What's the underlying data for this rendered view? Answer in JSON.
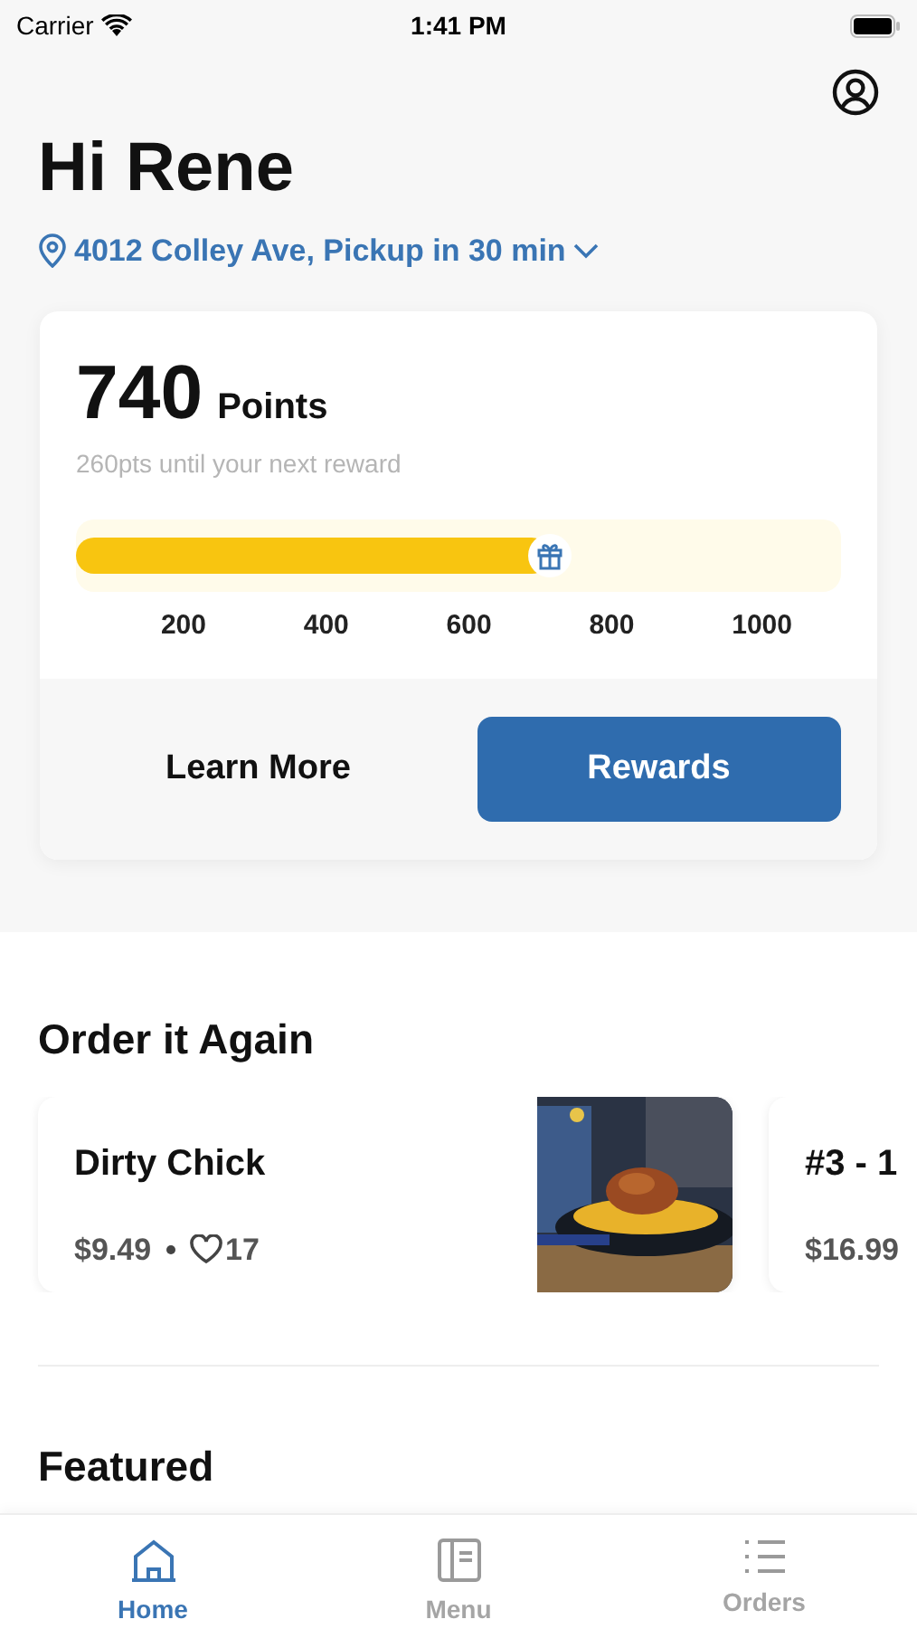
{
  "status_bar": {
    "carrier": "Carrier",
    "time": "1:41 PM"
  },
  "greeting": "Hi Rene",
  "location": "4012 Colley Ave, Pickup in 30 min",
  "rewards": {
    "points": "740",
    "points_label": "Points",
    "subtitle": "260pts until your next reward",
    "level": 0.62,
    "scale": [
      "200",
      "400",
      "600",
      "800",
      "1000"
    ],
    "buttons": [
      {
        "label": "Learn More",
        "kind": "plain"
      },
      {
        "label": "Rewards",
        "kind": "primary"
      }
    ]
  },
  "order_again": {
    "title": "Order it Again",
    "items": [
      {
        "name": "Dirty Chick",
        "price": "$9.49",
        "likes": "17",
        "kind": "picture"
      },
      {
        "name": "#3 - 1",
        "price": "$16.99"
      }
    ]
  },
  "featured": {
    "title": "Featured"
  },
  "tabs": [
    {
      "label": "Home",
      "selected": true
    },
    {
      "label": "Menu",
      "selected": false
    },
    {
      "label": "Orders",
      "selected": false
    }
  ]
}
